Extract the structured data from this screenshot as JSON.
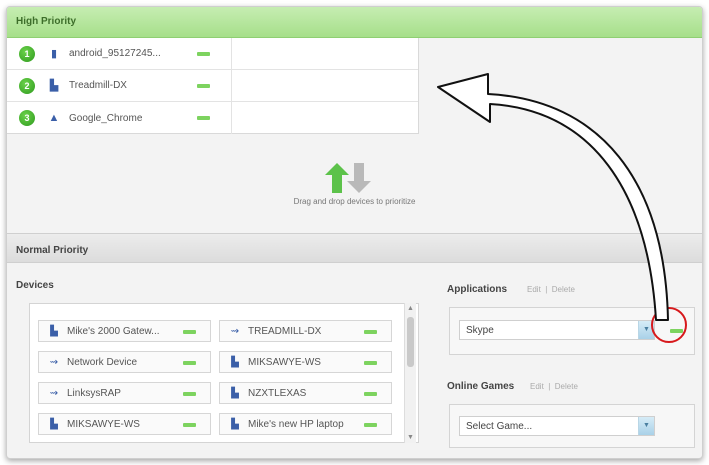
{
  "high_priority": {
    "title": "High Priority",
    "rows": [
      {
        "number": "1",
        "icon": "phone-icon",
        "label": "android_95127245..."
      },
      {
        "number": "2",
        "icon": "computer-icon",
        "label": "Treadmill-DX"
      },
      {
        "number": "3",
        "icon": "chrome-icon",
        "label": "Google_Chrome"
      }
    ]
  },
  "drag_zone": {
    "hint": "Drag and drop devices to prioritize"
  },
  "normal_priority": {
    "title": "Normal Priority",
    "devices_title": "Devices",
    "devices": [
      {
        "icon": "computer-icon",
        "label": "Mike's 2000 Gatew..."
      },
      {
        "icon": "network-device-icon",
        "label": "TREADMILL-DX"
      },
      {
        "icon": "network-device-icon",
        "label": "Network Device"
      },
      {
        "icon": "computer-icon",
        "label": "MIKSAWYE-WS"
      },
      {
        "icon": "network-device-icon",
        "label": "LinksysRAP"
      },
      {
        "icon": "computer-icon",
        "label": "NZXTLEXAS"
      },
      {
        "icon": "computer-icon",
        "label": "MIKSAWYE-WS"
      },
      {
        "icon": "computer-icon",
        "label": "Mike's new HP laptop"
      }
    ]
  },
  "applications": {
    "title": "Applications",
    "edit": "Edit",
    "separator": "|",
    "delete": "Delete",
    "selected": "Skype"
  },
  "online_games": {
    "title": "Online Games",
    "edit": "Edit",
    "separator": "|",
    "delete": "Delete",
    "selected": "Select Game..."
  },
  "colors": {
    "accent_green": "#7dd35f",
    "annotation_red": "#d7191c",
    "header_green": "#a6df8a"
  }
}
